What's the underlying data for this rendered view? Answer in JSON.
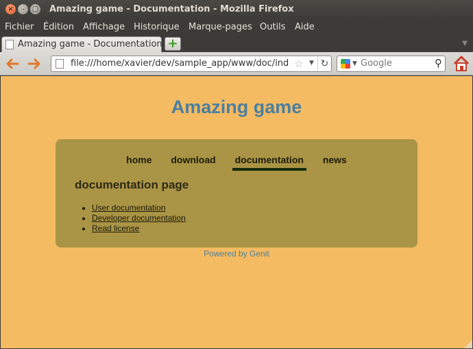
{
  "window": {
    "title": "Amazing game - Documentation - Mozilla Firefox"
  },
  "menu": [
    "Fichier",
    "Édition",
    "Affichage",
    "Historique",
    "Marque-pages",
    "Outils",
    "Aide"
  ],
  "tab": {
    "label": "Amazing game - Documentation"
  },
  "urlbar": {
    "url": "file:///home/xavier/dev/sample_app/www/doc/ind"
  },
  "search": {
    "placeholder": "Google"
  },
  "page": {
    "site_title": "Amazing game",
    "nav": [
      {
        "label": "home",
        "active": false
      },
      {
        "label": "download",
        "active": false
      },
      {
        "label": "documentation",
        "active": true
      },
      {
        "label": "news",
        "active": false
      }
    ],
    "section_title": "documentation page",
    "links": [
      "User documentation",
      "Developer documentation",
      "Read license"
    ],
    "footer": "Powered by Genit"
  },
  "colors": {
    "page_background": "#f4bb62",
    "panel_background": "#aa9445",
    "title_color": "#4a7fa0",
    "active_underline": "#132a0a"
  }
}
